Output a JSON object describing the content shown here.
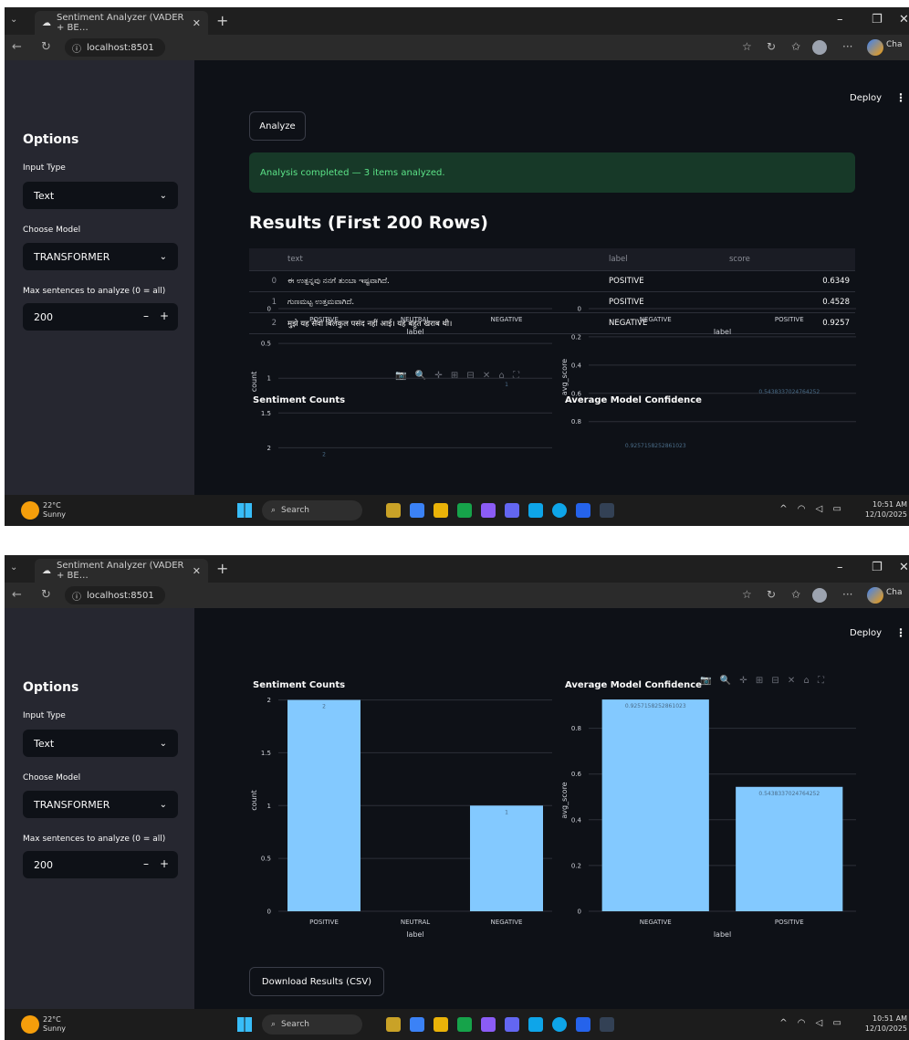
{
  "browser": {
    "tab_title": "Sentiment Analyzer (VADER + BE…",
    "url": "localhost:8501",
    "account_label": "Cha"
  },
  "app": {
    "deploy_label": "Deploy",
    "kebab": "⋮"
  },
  "sidebar": {
    "title": "Options",
    "input_type_label": "Input Type",
    "input_type_value": "Text",
    "model_label": "Choose Model",
    "model_value": "TRANSFORMER",
    "max_label": "Max sentences to analyze (0 = all)",
    "max_value": "200"
  },
  "main": {
    "analyze_label": "Analyze",
    "success_message": "Analysis completed — 3 items analyzed.",
    "results_heading": "Results (First 200 Rows)",
    "download_label": "Download Results (CSV)"
  },
  "table": {
    "columns": [
      "text",
      "label",
      "score"
    ],
    "rows": [
      {
        "index": "0",
        "text": "ಈ ಉತ್ಪನ್ನವು ನನಗೆ ತುಂಬಾ ಇಷ್ಟವಾಗಿದೆ.",
        "label": "POSITIVE",
        "score": "0.6349"
      },
      {
        "index": "1",
        "text": "ಗುಣಮಟ್ಟ ಉತ್ತಮವಾಗಿದೆ.",
        "label": "POSITIVE",
        "score": "0.4528"
      },
      {
        "index": "2",
        "text": "मुझे यह सेवा बिलकुल पसंद नहीं आई। यह बहुत खराब थी।",
        "label": "NEGATIVE",
        "score": "0.9257"
      }
    ]
  },
  "chart_data": [
    {
      "type": "bar",
      "title": "Sentiment Counts",
      "xlabel": "label",
      "ylabel": "count",
      "categories": [
        "POSITIVE",
        "NEUTRAL",
        "NEGATIVE"
      ],
      "values": [
        2,
        0,
        1
      ],
      "value_labels": [
        "2",
        "",
        "1"
      ],
      "yticks": [
        0,
        0.5,
        1,
        1.5,
        2
      ],
      "ytick_labels": [
        "0",
        "0.5",
        "1",
        "1.5",
        "2"
      ],
      "ylim": [
        0,
        2.1
      ],
      "color": "#83c9ff"
    },
    {
      "type": "bar",
      "title": "Average Model Confidence",
      "xlabel": "label",
      "ylabel": "avg_score",
      "categories": [
        "NEGATIVE",
        "POSITIVE"
      ],
      "values": [
        0.9257158252861023,
        0.5438337024764252
      ],
      "value_labels": [
        "0.9257158252861023",
        "0.5438337024764252"
      ],
      "yticks": [
        0,
        0.2,
        0.4,
        0.6,
        0.8
      ],
      "ytick_labels": [
        "0",
        "0.2",
        "0.4",
        "0.6",
        "0.8"
      ],
      "ylim": [
        0,
        0.97
      ],
      "color": "#83c9ff"
    }
  ],
  "taskbar": {
    "temp": "22°C",
    "condition": "Sunny",
    "search_label": "Search",
    "time": "10:51 AM",
    "date": "12/10/2025"
  }
}
